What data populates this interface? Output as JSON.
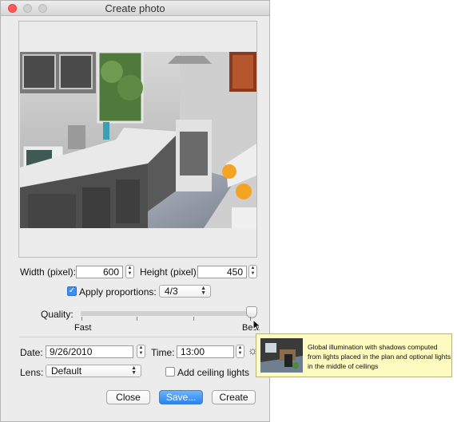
{
  "window": {
    "title": "Create photo"
  },
  "size": {
    "width_label": "Width (pixel):",
    "width_value": "600",
    "height_label": "Height (pixel):",
    "height_value": "450"
  },
  "proportions": {
    "label": "Apply proportions:",
    "checked": true,
    "value": "4/3"
  },
  "quality": {
    "label": "Quality:",
    "min_label": "Fast",
    "max_label": "Best",
    "level": 1.0
  },
  "date": {
    "label": "Date:",
    "value": "9/26/2010"
  },
  "time": {
    "label": "Time:",
    "value": "13:00"
  },
  "lens": {
    "label": "Lens:",
    "value": "Default"
  },
  "ceiling": {
    "label": "Add ceiling lights",
    "checked": false
  },
  "buttons": {
    "close": "Close",
    "save": "Save...",
    "create": "Create"
  },
  "tooltip": {
    "text": "Global illumination with shadows computed from lights placed in the plan and optional lights in the middle of ceilings"
  },
  "icons": {
    "daylight": "sun-icon",
    "cursor": "arrow-cursor-icon"
  }
}
